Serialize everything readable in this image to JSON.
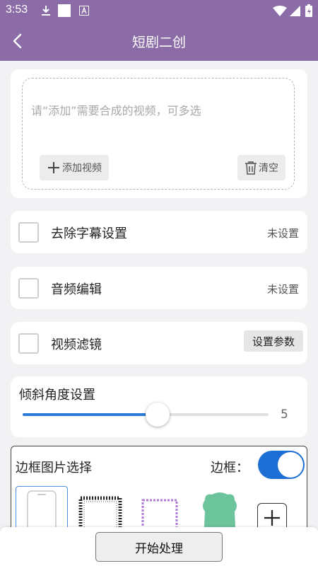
{
  "status_bar": {
    "time": "3:53"
  },
  "header": {
    "title": "短剧二创"
  },
  "upload": {
    "placeholder": "请“添加”需要合成的视频，可多选",
    "add_label": "添加视频",
    "clear_label": "清空"
  },
  "options": [
    {
      "label": "去除字幕设置",
      "value": "未设置",
      "checked": false
    },
    {
      "label": "音频编辑",
      "value": "未设置",
      "checked": false
    },
    {
      "label": "视频滤镜",
      "button": "设置参数",
      "checked": false
    }
  ],
  "tilt": {
    "label": "倾斜角度设置",
    "value": "5",
    "fraction": 0.55
  },
  "frame": {
    "label": "边框图片选择",
    "toggle_label": "边框：",
    "toggle_on": true,
    "frames": [
      "phone-frame",
      "black-lace-frame",
      "purple-lace-frame",
      "green-badge-frame"
    ],
    "selected_index": 0
  },
  "footer": {
    "start_label": "开始处理"
  },
  "colors": {
    "accent": "#8b6ca6",
    "toggle": "#1e6fd5",
    "slider": "#2c7ad8"
  }
}
